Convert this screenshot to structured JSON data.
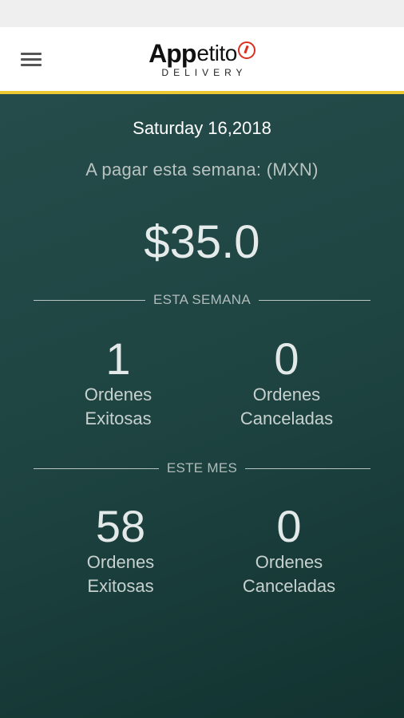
{
  "app": {
    "logo_primary": "App",
    "logo_secondary": "etito",
    "logo_tagline": "DELIVERY",
    "accent_color": "#ecc832",
    "brand_red": "#d8311f"
  },
  "header": {
    "menu_icon": "hamburger-menu-icon"
  },
  "summary": {
    "date": "Saturday 16,2018",
    "to_pay_label": "A pagar esta semana: (MXN)",
    "amount": "$35.0"
  },
  "week": {
    "label": "ESTA SEMANA",
    "successful": {
      "count": "1",
      "line1": "Ordenes",
      "line2": "Exitosas"
    },
    "cancelled": {
      "count": "0",
      "line1": "Ordenes",
      "line2": "Canceladas"
    }
  },
  "month": {
    "label": "ESTE MES",
    "successful": {
      "count": "58",
      "line1": "Ordenes",
      "line2": "Exitosas"
    },
    "cancelled": {
      "count": "0",
      "line1": "Ordenes",
      "line2": "Canceladas"
    }
  }
}
